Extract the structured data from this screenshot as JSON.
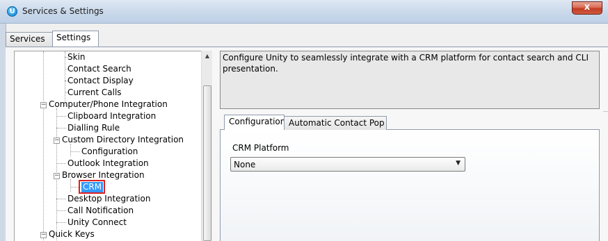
{
  "window": {
    "title": "Services & Settings",
    "close_glyph": "x",
    "app_icon_glyph": "U",
    "app_icon_name": "unity-app-icon"
  },
  "top_tabs": [
    {
      "label": "Services",
      "active": false
    },
    {
      "label": "Settings",
      "active": true
    }
  ],
  "tree": {
    "nodes": [
      {
        "label": "Skin",
        "level": 2
      },
      {
        "label": "Contact Search",
        "level": 2
      },
      {
        "label": "Contact Display",
        "level": 2
      },
      {
        "label": "Current Calls",
        "level": 2
      },
      {
        "label": "Computer/Phone Integration",
        "level": 1,
        "expanded": true
      },
      {
        "label": "Clipboard Integration",
        "level": 2
      },
      {
        "label": "Dialling Rule",
        "level": 2
      },
      {
        "label": "Custom Directory Integration",
        "level": 2,
        "expanded": true
      },
      {
        "label": "Configuration",
        "level": 3
      },
      {
        "label": "Outlook Integration",
        "level": 2
      },
      {
        "label": "Browser Integration",
        "level": 2,
        "expanded": true
      },
      {
        "label": "CRM",
        "level": 3,
        "selected": true
      },
      {
        "label": "Desktop Integration",
        "level": 2
      },
      {
        "label": "Call Notification",
        "level": 2
      },
      {
        "label": "Unity Connect",
        "level": 2
      },
      {
        "label": "Quick Keys",
        "level": 1,
        "expanded": true
      }
    ]
  },
  "scrollbar": {
    "up_glyph": "▲"
  },
  "description": "Configure Unity to seamlessly integrate with a CRM platform for contact search and CLI presentation.",
  "inner_tabs": [
    {
      "label": "Configuration",
      "active": true
    },
    {
      "label": "Automatic Contact Pop",
      "active": false
    }
  ],
  "crm": {
    "label": "CRM Platform",
    "selected_value": "None",
    "dropdown_glyph": "▼"
  },
  "colors": {
    "selection": "#3399ff",
    "highlight_box": "#e02020"
  }
}
